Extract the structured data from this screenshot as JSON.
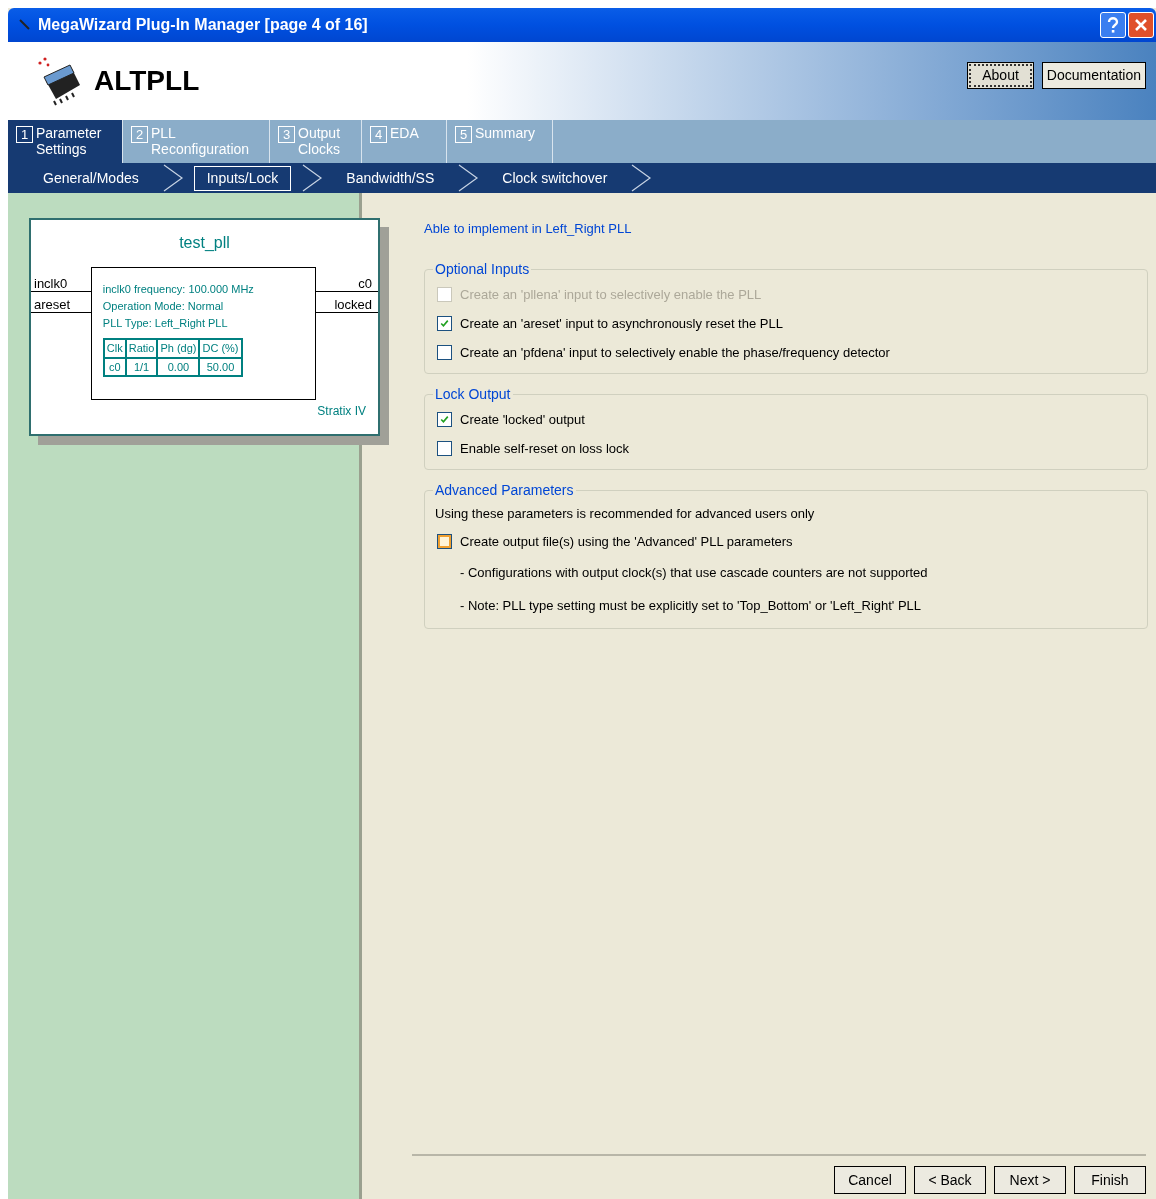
{
  "window": {
    "title": "MegaWizard Plug-In Manager [page 4 of 16]"
  },
  "header": {
    "title": "ALTPLL",
    "buttons": [
      {
        "label": "About",
        "focused": true
      },
      {
        "label": "Documentation",
        "focused": false
      }
    ]
  },
  "tabs": [
    {
      "number": "1",
      "lines": [
        "Parameter",
        "Settings"
      ],
      "selected": true
    },
    {
      "number": "2",
      "lines": [
        "PLL",
        "Reconfiguration"
      ],
      "selected": false
    },
    {
      "number": "3",
      "lines": [
        "Output",
        "Clocks"
      ],
      "selected": false
    },
    {
      "number": "4",
      "lines": [
        "EDA"
      ],
      "selected": false
    },
    {
      "number": "5",
      "lines": [
        "Summary"
      ],
      "selected": false
    }
  ],
  "subtabs": [
    {
      "label": "General/Modes",
      "selected": false
    },
    {
      "label": "Inputs/Lock",
      "selected": true
    },
    {
      "label": "Bandwidth/SS",
      "selected": false
    },
    {
      "label": "Clock switchover",
      "selected": false
    }
  ],
  "diagram": {
    "name": "test_pll",
    "inputs": [
      "inclk0",
      "areset"
    ],
    "outputs": [
      "c0",
      "locked"
    ],
    "info": [
      "inclk0 frequency: 100.000 MHz",
      "Operation Mode: Normal",
      "PLL Type: Left_Right PLL"
    ],
    "table": {
      "columns": [
        "Clk",
        "Ratio",
        "Ph (dg)",
        "DC (%)"
      ],
      "rows": [
        [
          "c0",
          "1/1",
          "0.00",
          "50.00"
        ]
      ]
    },
    "device": "Stratix IV"
  },
  "status": "Able to implement in Left_Right PLL",
  "groups": [
    {
      "title": "Optional Inputs",
      "items": [
        {
          "kind": "checkbox",
          "label": "Create an 'pllena' input to selectively enable the PLL",
          "checked": false,
          "disabled": true
        },
        {
          "kind": "checkbox",
          "label": "Create an 'areset' input to asynchronously reset the PLL",
          "checked": true,
          "disabled": false
        },
        {
          "kind": "checkbox",
          "label": "Create an 'pfdena' input to selectively enable the phase/frequency detector",
          "checked": false,
          "disabled": false
        }
      ]
    },
    {
      "title": "Lock Output",
      "items": [
        {
          "kind": "checkbox",
          "label": "Create 'locked' output",
          "checked": true,
          "disabled": false
        },
        {
          "kind": "checkbox",
          "label": "Enable self-reset on loss lock",
          "checked": false,
          "disabled": false
        }
      ]
    },
    {
      "title": "Advanced Parameters",
      "items": [
        {
          "kind": "text",
          "label": "Using these parameters is recommended for advanced users only"
        },
        {
          "kind": "hot-checkbox",
          "label": "Create output file(s) using the 'Advanced' PLL parameters",
          "checked": false,
          "disabled": false
        },
        {
          "kind": "note",
          "label": "- Configurations with output clock(s) that use cascade counters are not supported"
        },
        {
          "kind": "note",
          "label": "- Note: PLL type setting must be explicitly set to 'Top_Bottom' or 'Left_Right' PLL"
        }
      ]
    }
  ],
  "buttons": [
    "Cancel",
    "< Back",
    "Next >",
    "Finish"
  ]
}
